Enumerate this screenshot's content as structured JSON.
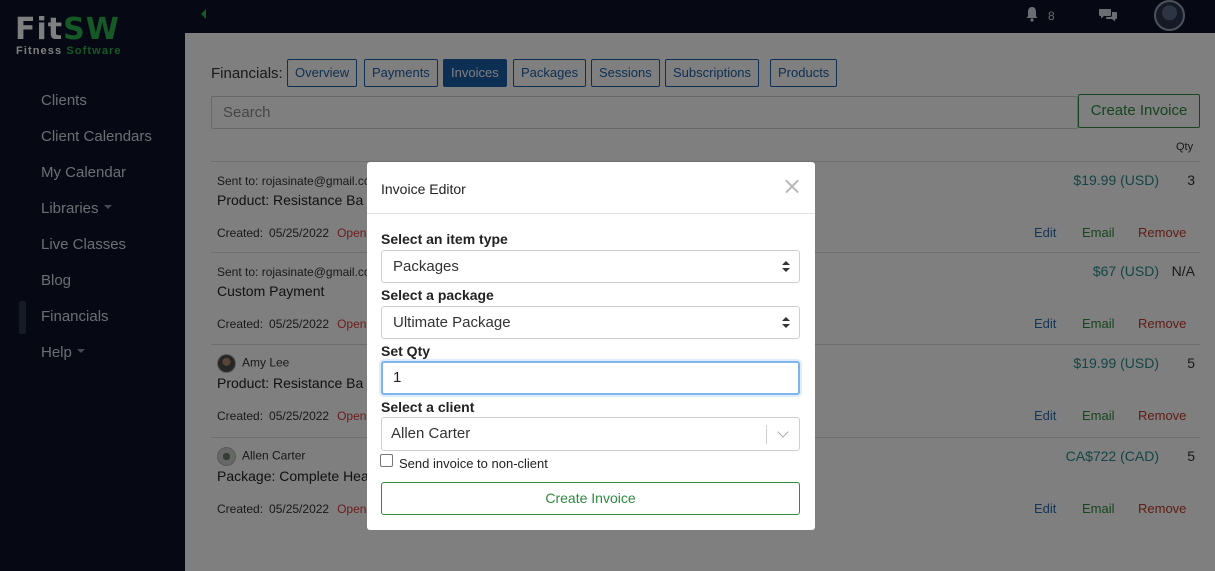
{
  "topbar": {
    "notification_count": "8"
  },
  "logo": {
    "fit": "Fit",
    "sw": "SW",
    "sub_a": "Fitness ",
    "sub_b": "Software"
  },
  "sidebar": {
    "items": [
      {
        "label": "Clients"
      },
      {
        "label": "Client Calendars"
      },
      {
        "label": "My Calendar"
      },
      {
        "label": "Libraries"
      },
      {
        "label": "Live Classes"
      },
      {
        "label": "Blog"
      },
      {
        "label": "Financials"
      },
      {
        "label": "Help"
      }
    ]
  },
  "financials": {
    "label": "Financials:",
    "tabs": [
      "Overview",
      "Payments",
      "Invoices",
      "Packages",
      "Sessions",
      "Subscriptions",
      "Products"
    ],
    "active_tab": "Invoices"
  },
  "search": {
    "placeholder": "Search"
  },
  "create_invoice_label": "Create Invoice",
  "table": {
    "qty_header": "Qty",
    "rows": [
      {
        "sent": "Sent to: rojasinate@gmail.com",
        "title": "Product: Resistance Ba",
        "created_label": "Created:",
        "date": "05/25/2022",
        "status": "Open",
        "price": "$19.99 (USD)",
        "qty": "3"
      },
      {
        "sent": "Sent to: rojasinate@gmail.com",
        "title": "Custom Payment",
        "created_label": "Created:",
        "date": "05/25/2022",
        "status": "Open",
        "price": "$67 (USD)",
        "qty": "N/A"
      },
      {
        "person": "Amy Lee",
        "title": "Product: Resistance Ba",
        "created_label": "Created:",
        "date": "05/25/2022",
        "status": "Open",
        "price": "$19.99 (USD)",
        "qty": "5"
      },
      {
        "person": "Allen Carter",
        "title": "Package: Complete Hea",
        "created_label": "Created:",
        "date": "05/25/2022",
        "status": "Open",
        "price": "CA$722 (CAD)",
        "qty": "5"
      }
    ],
    "actions": {
      "edit": "Edit",
      "email": "Email",
      "remove": "Remove"
    }
  },
  "modal": {
    "title": "Invoice Editor",
    "close": "×",
    "item_type_label": "Select an item type",
    "item_type_value": "Packages",
    "package_label": "Select a package",
    "package_value": "Ultimate Package",
    "qty_label": "Set Qty",
    "qty_value": "1",
    "client_label": "Select a client",
    "client_value": "Allen Carter",
    "non_client_label": "Send invoice to non-client",
    "create_label": "Create Invoice"
  },
  "colors": {
    "sidebar_bg": "#0c1327",
    "brand_green": "#2bb24c",
    "tab_blue": "#1d5fa8",
    "open_red": "#d93a3a"
  }
}
